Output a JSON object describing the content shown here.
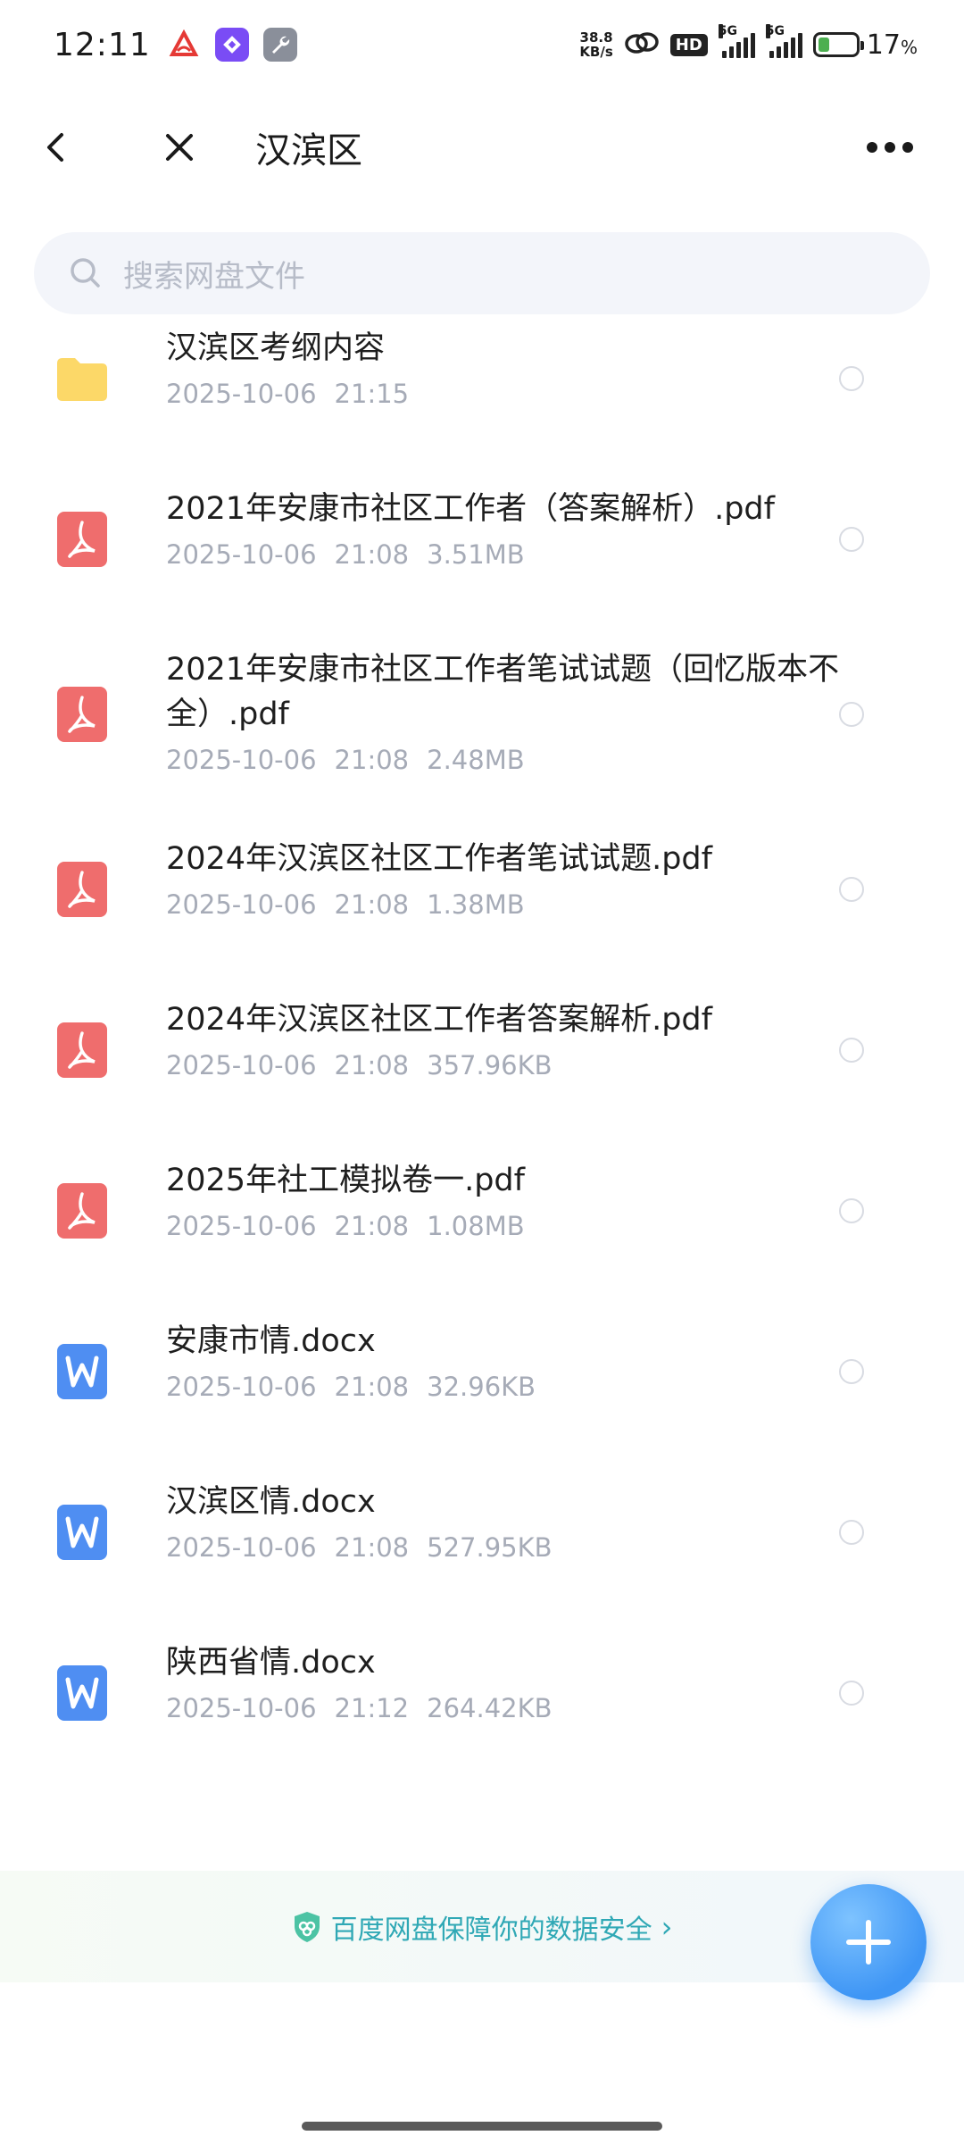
{
  "status_bar": {
    "time": "12:11",
    "net_speed_value": "38.8",
    "net_speed_unit": "KB/s",
    "hd_badge": "HD",
    "signal_label_1": "5G",
    "signal_label_2": "5G",
    "battery_percent": "17",
    "battery_percent_unit": "%",
    "battery_level": 0.17
  },
  "header": {
    "title": "汉滨区",
    "back_icon": "chevron-left-icon",
    "close_icon": "close-icon",
    "more_icon": "more-horizontal-icon"
  },
  "search": {
    "placeholder": "搜索网盘文件"
  },
  "files": [
    {
      "name": "汉滨区考纲内容",
      "date": "2025-10-06",
      "time": "21:15",
      "size": "",
      "type": "folder"
    },
    {
      "name": "2021年安康市社区工作者（答案解析）.pdf",
      "date": "2025-10-06",
      "time": "21:08",
      "size": "3.51MB",
      "type": "pdf"
    },
    {
      "name": "2021年安康市社区工作者笔试试题（回忆版本不全）.pdf",
      "date": "2025-10-06",
      "time": "21:08",
      "size": "2.48MB",
      "type": "pdf"
    },
    {
      "name": "2024年汉滨区社区工作者笔试试题.pdf",
      "date": "2025-10-06",
      "time": "21:08",
      "size": "1.38MB",
      "type": "pdf"
    },
    {
      "name": "2024年汉滨区社区工作者答案解析.pdf",
      "date": "2025-10-06",
      "time": "21:08",
      "size": "357.96KB",
      "type": "pdf"
    },
    {
      "name": "2025年社工模拟卷一.pdf",
      "date": "2025-10-06",
      "time": "21:08",
      "size": "1.08MB",
      "type": "pdf"
    },
    {
      "name": "安康市情.docx",
      "date": "2025-10-06",
      "time": "21:08",
      "size": "32.96KB",
      "type": "docx"
    },
    {
      "name": "汉滨区情.docx",
      "date": "2025-10-06",
      "time": "21:08",
      "size": "527.95KB",
      "type": "docx"
    },
    {
      "name": "陕西省情.docx",
      "date": "2025-10-06",
      "time": "21:12",
      "size": "264.42KB",
      "type": "docx"
    }
  ],
  "footer": {
    "safety_text": "百度网盘保障你的数据安全",
    "safety_arrow": "›",
    "fab_icon": "plus-icon"
  },
  "colors": {
    "accent": "#3f96f5",
    "folder": "#fcd868",
    "pdf": "#ef6d6d",
    "docx": "#4f8ef2",
    "safety_text": "#2fa8b5"
  }
}
